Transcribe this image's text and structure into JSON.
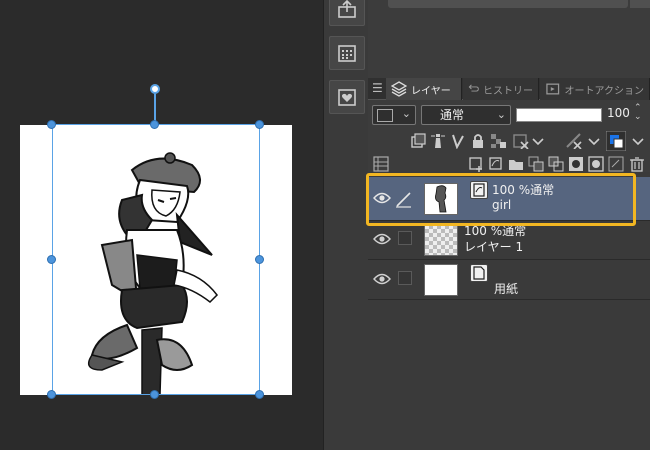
{
  "panel": {
    "tabs": [
      {
        "label": "レイヤー",
        "icon": "layers-icon",
        "active": true
      },
      {
        "label": "ヒストリー",
        "icon": "history-icon",
        "active": false
      },
      {
        "label": "オートアクション",
        "icon": "auto-action-icon",
        "active": false
      }
    ],
    "blend_mode": "通常",
    "opacity_value": "100",
    "opacity_fraction": 1.0
  },
  "layers": [
    {
      "opacity_mode": "100 %通常",
      "name": "girl",
      "selected": true,
      "thumbnail": "character-thumbnail"
    },
    {
      "opacity_mode": "100 %通常",
      "name": "レイヤー 1",
      "selected": false,
      "thumbnail": "transparent-thumbnail"
    },
    {
      "opacity_mode": "",
      "name": "用紙",
      "selected": false,
      "thumbnail": "paper-thumbnail"
    }
  ],
  "colors": {
    "selection_accent": "#f2b622",
    "transform_handles": "#4c94dc",
    "selected_layer_bg": "#56657f"
  }
}
